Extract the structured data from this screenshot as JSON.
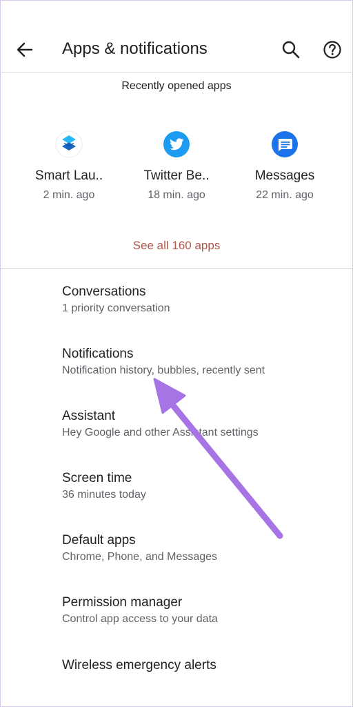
{
  "header": {
    "title": "Apps & notifications",
    "back_icon": "arrow-back-icon",
    "search_icon": "search-icon",
    "help_icon": "help-icon"
  },
  "recent": {
    "title": "Recently opened apps",
    "apps": [
      {
        "name": "Smart Lau..",
        "time": "2 min. ago",
        "icon": "smart-launcher-icon",
        "color": "#1e88e5"
      },
      {
        "name": "Twitter Be..",
        "time": "18 min. ago",
        "icon": "twitter-icon",
        "color": "#1d9bf0"
      },
      {
        "name": "Messages",
        "time": "22 min. ago",
        "icon": "messages-icon",
        "color": "#1a73e8"
      }
    ],
    "see_all": "See all 160 apps"
  },
  "settings": [
    {
      "title": "Conversations",
      "subtitle": "1 priority conversation"
    },
    {
      "title": "Notifications",
      "subtitle": "Notification history, bubbles, recently sent"
    },
    {
      "title": "Assistant",
      "subtitle": "Hey Google and other Assistant settings"
    },
    {
      "title": "Screen time",
      "subtitle": "36 minutes today"
    },
    {
      "title": "Default apps",
      "subtitle": "Chrome, Phone, and Messages"
    },
    {
      "title": "Permission manager",
      "subtitle": "Control app access to your data"
    },
    {
      "title": "Wireless emergency alerts",
      "subtitle": ""
    }
  ],
  "colors": {
    "accent_link": "#b0574a",
    "annotation_arrow": "#a774e6",
    "divider": "#dadce0"
  }
}
